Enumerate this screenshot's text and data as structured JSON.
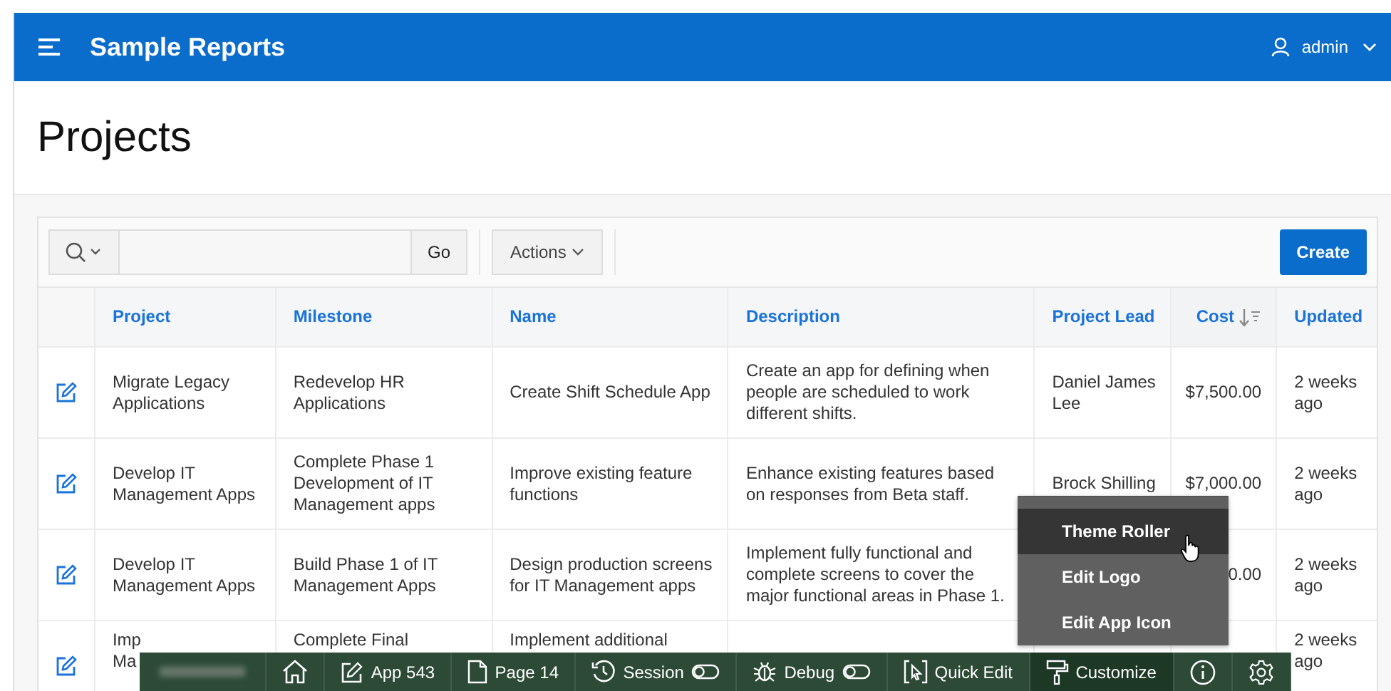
{
  "header": {
    "title": "Sample Reports",
    "user": "admin"
  },
  "page_title": "Projects",
  "report_toolbar": {
    "go": "Go",
    "actions": "Actions",
    "create": "Create"
  },
  "table": {
    "columns": [
      {
        "label": "Project",
        "sorted": false
      },
      {
        "label": "Milestone",
        "sorted": false
      },
      {
        "label": "Name",
        "sorted": false
      },
      {
        "label": "Description",
        "sorted": false
      },
      {
        "label": "Project Lead",
        "sorted": false
      },
      {
        "label": "Cost",
        "sorted": true
      },
      {
        "label": "Updated",
        "sorted": false
      }
    ],
    "rows": [
      {
        "cells": [
          "Migrate Legacy Applications",
          "Redevelop HR Applications",
          "Create Shift Schedule App",
          "Create an app for defining when people are scheduled to work different shifts.",
          "Daniel James Lee",
          "$7,500.00",
          "2 weeks ago"
        ]
      },
      {
        "cells": [
          "Develop IT Management Apps",
          "Complete Phase 1 Development of IT Management apps",
          "Improve existing feature functions",
          "Enhance existing features based on responses from Beta staff.",
          "Brock Shilling",
          "$7,000.00",
          "2 weeks ago"
        ]
      },
      {
        "cells": [
          "Develop IT Management Apps",
          "Build Phase 1 of IT Management Apps",
          "Design production screens for IT Management apps",
          "Implement fully functional and complete screens to cover the major functional areas in Phase 1.",
          null,
          "0.00",
          "2 weeks ago"
        ]
      },
      {
        "cells": [
          [
            "Imp",
            "Ma"
          ],
          "Complete Final",
          "Implement additional",
          null,
          null,
          null,
          "2 weeks ago"
        ]
      }
    ]
  },
  "dev_toolbar": {
    "items": [
      {
        "kind": "redacted"
      },
      {
        "kind": "home"
      },
      {
        "kind": "app",
        "label": "App 543"
      },
      {
        "kind": "page",
        "label": "Page 14"
      },
      {
        "kind": "session",
        "label": "Session"
      },
      {
        "kind": "debug",
        "label": "Debug"
      },
      {
        "kind": "quick_edit",
        "label": "Quick Edit"
      },
      {
        "kind": "customize",
        "label": "Customize",
        "selected": true
      },
      {
        "kind": "info"
      },
      {
        "kind": "settings"
      }
    ]
  },
  "customize_menu": {
    "items": [
      {
        "label": "Theme Roller",
        "selected": true
      },
      {
        "label": "Edit Logo",
        "selected": false
      },
      {
        "label": "Edit App Icon",
        "selected": false
      }
    ]
  }
}
